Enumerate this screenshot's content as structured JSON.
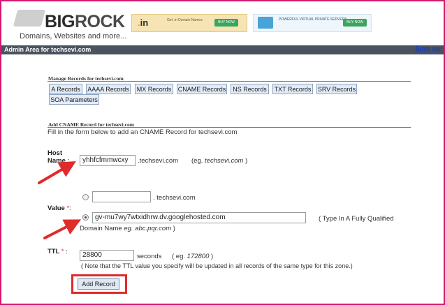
{
  "header": {
    "logo_text_big": "BIG",
    "logo_text_rock": "ROCK",
    "logo_tagline": "Domains, Websites and more...",
    "banner1_text": "Get .in Domain Names",
    "banner1_button": "BUY NOW",
    "banner2_text": "POWERFUL VIRTUAL PRIVATE SERVERS",
    "banner2_button": "BUY NOW"
  },
  "admin_bar": {
    "title": "Admin Area for techsevi.com",
    "signout": "Sign ou"
  },
  "manage": {
    "heading": "Manage Records for techsevi.com",
    "buttons": [
      "A Records",
      "AAAA Records",
      "MX Records",
      "CNAME Records",
      "NS Records",
      "TXT Records",
      "SRV Records",
      "SOA Parameters"
    ]
  },
  "form": {
    "heading": "Add CNAME Record for techsevi.com",
    "intro": "Fill in the form below to add an CNAME Record for techsevi.com",
    "host": {
      "label_line1": "Host",
      "label_line2": "Name",
      "colon": ":",
      "value": "yhhfcfmmwcxy",
      "suffix": ".techsevi.com",
      "example_prefix": "(eg.",
      "example_domain": "techsevi.com",
      "example_suffix": ")"
    },
    "value": {
      "label": "Value",
      "req": "*",
      "colon": ":",
      "option1_value": "",
      "option1_suffix": ". techsevi.com",
      "option2_value": "gv-mu7wy7wtxidhrw.dv.googlehosted.com",
      "option2_hint": "( Type In A Fully Qualified",
      "option2_hint2": "Domain Name",
      "option2_example": "eg. abc.pqr.com",
      "option2_hint_end": ")"
    },
    "ttl": {
      "label": "TTL",
      "req": "*",
      "colon": ":",
      "value": "28800",
      "unit": "seconds",
      "example_prefix": "( eg.",
      "example_value": "172800",
      "example_suffix": ")",
      "note": "( Note that the TTL value you specify will be updated in all records of the same type for this zone.)"
    },
    "submit": "Add Record"
  },
  "colors": {
    "frame": "#d4186f",
    "admin_bar": "#4b5360",
    "annotation_red": "#e02b2b",
    "required": "#e0247a"
  }
}
